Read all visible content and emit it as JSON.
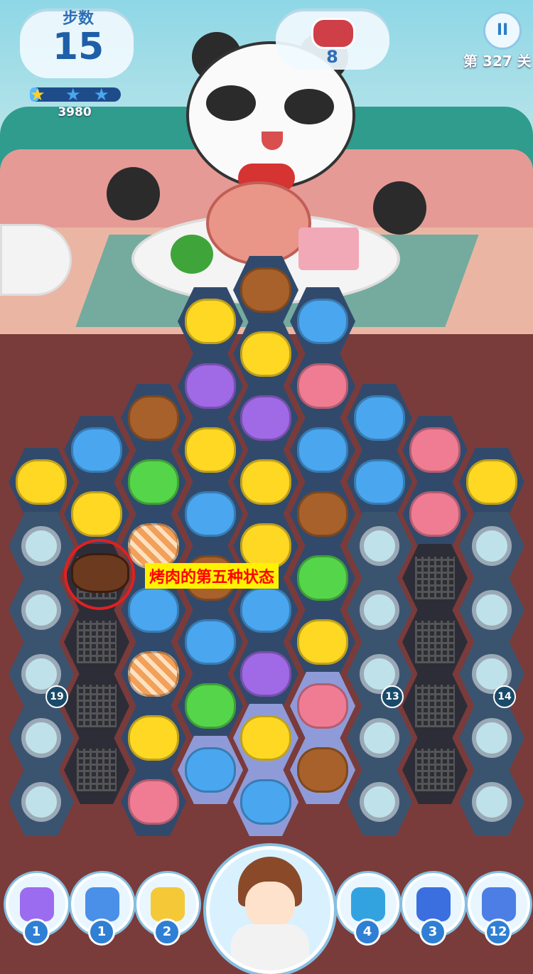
{
  "hud": {
    "steps_label": "步数",
    "steps_value": "15",
    "score": "3980",
    "score_progress": 0.1,
    "target_count": "8",
    "target_icon": "meat-icon",
    "pause_label": "II",
    "level": "第 327 关"
  },
  "board": {
    "annotation": "烤肉的第五种状态",
    "counters": [
      "19",
      "13",
      "14"
    ]
  },
  "toolbar": {
    "tools": [
      {
        "icon": "hammer-icon",
        "count": "1",
        "color": "#9b6cf0"
      },
      {
        "icon": "rocket-icon",
        "count": "1",
        "color": "#4a8fe8"
      },
      {
        "icon": "balloon-icon",
        "count": "2",
        "color": "#f5c838"
      },
      {
        "icon": "swap-icon",
        "count": "4",
        "color": "#33a3e0"
      },
      {
        "icon": "shuffle-icon",
        "count": "3",
        "color": "#3b6fe0"
      },
      {
        "icon": "hourglass-icon",
        "count": "12",
        "color": "#4d7ee6"
      }
    ]
  },
  "colors": {
    "chick": "#ffd824",
    "bear": "#a8612a",
    "blue": "#4aa6ef",
    "cat": "#a06ae6",
    "deer": "#f07c94",
    "frog": "#55d64a",
    "striped": "#f2a05a"
  }
}
